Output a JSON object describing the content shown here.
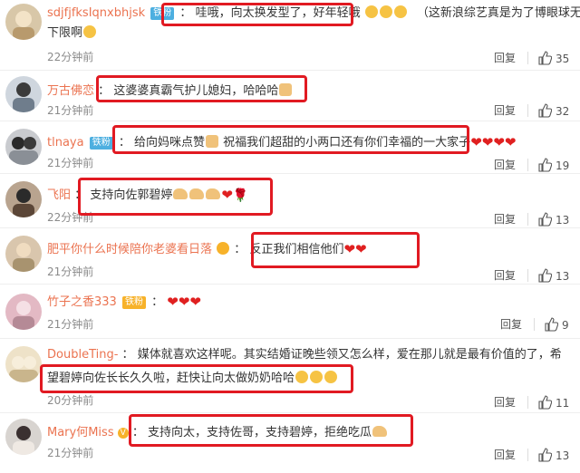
{
  "comments": [
    {
      "user": "sdjfjfksIqnxbhjsk",
      "badge": "铁粉",
      "text_line1": "哇哦，向太换发型了，好年轻哦",
      "text_tail": "（这新浪综艺真是为了博眼球无",
      "text_line2": "下限啊",
      "time": "22分钟前",
      "reply_label": "回复",
      "likes": "35"
    },
    {
      "user": "万古佛恋",
      "text_line1": "这婆婆真霸气护儿媳妇，哈哈哈",
      "time": "21分钟前",
      "reply_label": "回复",
      "likes": "32"
    },
    {
      "user": "tlnaya",
      "badge": "铁粉",
      "text_line1": "给向妈咪点赞",
      "text_tail": "祝福我们超甜的小两口还有你们幸福的一大家子",
      "time": "21分钟前",
      "reply_label": "回复",
      "likes": "19"
    },
    {
      "user": "飞阳",
      "text_line1": "支持向佐郭碧婷",
      "time": "22分钟前",
      "reply_label": "回复",
      "likes": "13"
    },
    {
      "user": "肥平你什么时候陪你老婆看日落",
      "text_line1": "反正我们相信他们",
      "time": "21分钟前",
      "reply_label": "回复",
      "likes": "13"
    },
    {
      "user": "竹子之香333",
      "badge": "铁粉",
      "time": "21分钟前",
      "reply_label": "回复",
      "likes": "9"
    },
    {
      "user": "DoubleTing-",
      "text_line1": "媒体就喜欢这样呢。其实结婚证晚些领又怎么样，爱在那儿就是最有价值的了，希",
      "text_line2": "望碧婷向佐长长久久啦，赶快让向太做奶奶哈哈",
      "time": "20分钟前",
      "reply_label": "回复",
      "likes": "11"
    },
    {
      "user": "Mary何Miss",
      "text_line1": "支持向太，支持佐哥，支持碧婷，拒绝吃瓜",
      "time": "21分钟前",
      "reply_label": "回复",
      "likes": "13"
    }
  ],
  "colors": {
    "username": "#eb7350",
    "highlight_box": "#e11a22",
    "badge_blue": "#4dafe0",
    "badge_gold": "#f7b22a"
  }
}
